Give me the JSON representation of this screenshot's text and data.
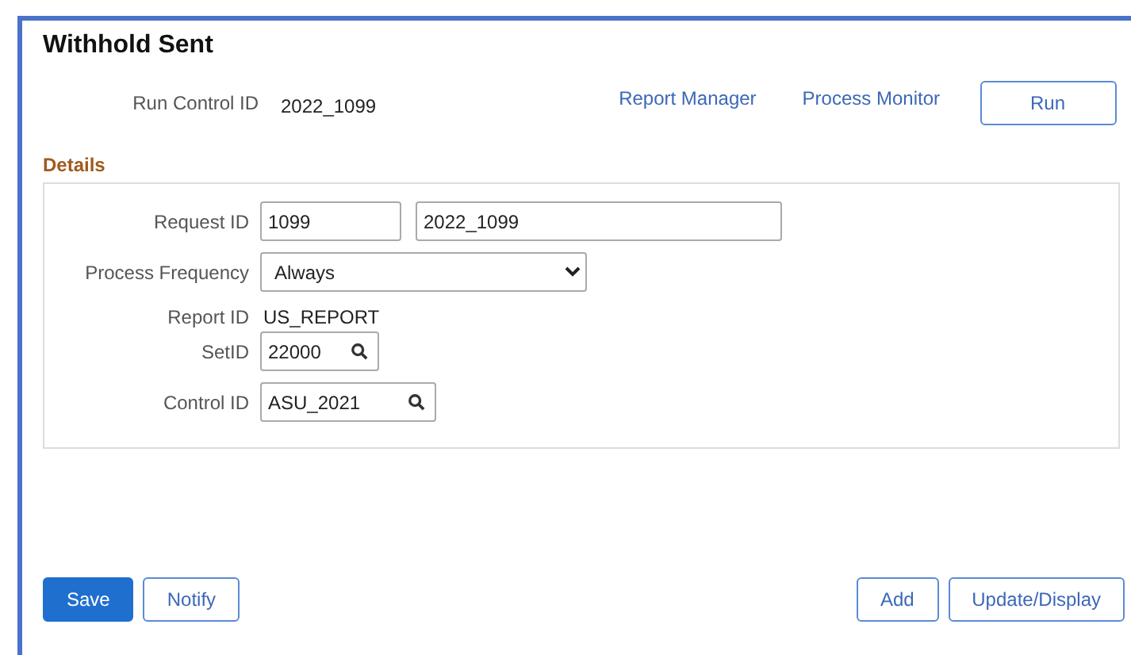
{
  "title": "Withhold Sent",
  "run_control": {
    "label": "Run Control ID",
    "value": "2022_1099"
  },
  "links": [
    "Report Manager",
    "Process Monitor"
  ],
  "run_button": "Run",
  "section_title": "Details",
  "fields": [
    {
      "kind": "text",
      "label": "Request ID",
      "values": [
        "1099",
        "2022_1099"
      ]
    },
    {
      "kind": "select",
      "label": "Process Frequency",
      "value": "Always"
    },
    {
      "kind": "readonly",
      "label": "Report ID",
      "value": "US_REPORT"
    },
    {
      "kind": "lookup",
      "label": "SetID",
      "value": "22000"
    },
    {
      "kind": "lookup",
      "label": "Control ID",
      "value": "ASU_2021"
    }
  ],
  "left_buttons": [
    {
      "label": "Save",
      "primary": true
    },
    {
      "label": "Notify",
      "primary": false
    }
  ],
  "right_buttons": [
    {
      "label": "Add",
      "primary": false
    },
    {
      "label": "Update/Display",
      "primary": false
    }
  ]
}
